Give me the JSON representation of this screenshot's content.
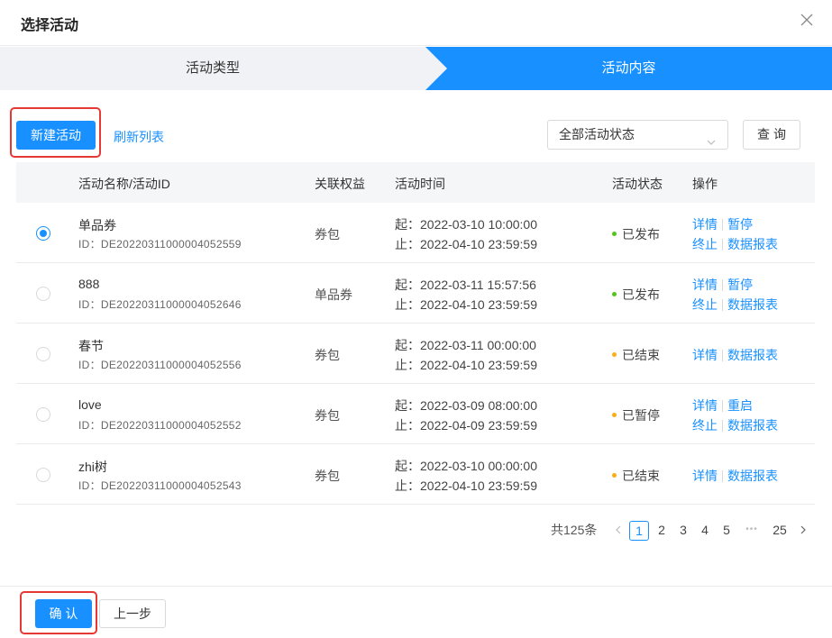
{
  "dialog": {
    "title": "选择活动"
  },
  "steps": [
    {
      "label": "活动类型"
    },
    {
      "label": "活动内容"
    }
  ],
  "toolbar": {
    "new_label": "新建活动",
    "refresh_label": "刷新列表",
    "status_select": "全部活动状态",
    "query_label": "查询"
  },
  "table": {
    "headers": {
      "name": "活动名称/活动ID",
      "benefit": "关联权益",
      "time": "活动时间",
      "status": "活动状态",
      "ops": "操作"
    },
    "rows": [
      {
        "selected": true,
        "name": "单品券",
        "id": "ID：DE20220311000004052559",
        "benefit": "券包",
        "start": "起：2022-03-10 10:00:00",
        "end": "止：2022-04-10 23:59:59",
        "status": "已发布",
        "status_color": "#52c41a",
        "ops_line1": [
          "详情",
          "暂停"
        ],
        "ops_line2": [
          "终止",
          "数据报表"
        ]
      },
      {
        "selected": false,
        "name": "888",
        "id": "ID：DE20220311000004052646",
        "benefit": "单品券",
        "start": "起：2022-03-11 15:57:56",
        "end": "止：2022-04-10 23:59:59",
        "status": "已发布",
        "status_color": "#52c41a",
        "ops_line1": [
          "详情",
          "暂停"
        ],
        "ops_line2": [
          "终止",
          "数据报表"
        ]
      },
      {
        "selected": false,
        "name": "春节",
        "id": "ID：DE20220311000004052556",
        "benefit": "券包",
        "start": "起：2022-03-11 00:00:00",
        "end": "止：2022-04-10 23:59:59",
        "status": "已结束",
        "status_color": "#faad14",
        "ops_line1": [
          "详情",
          "数据报表"
        ],
        "ops_line2": []
      },
      {
        "selected": false,
        "name": "love",
        "id": "ID：DE20220311000004052552",
        "benefit": "券包",
        "start": "起：2022-03-09 08:00:00",
        "end": "止：2022-04-09 23:59:59",
        "status": "已暂停",
        "status_color": "#faad14",
        "ops_line1": [
          "详情",
          "重启"
        ],
        "ops_line2": [
          "终止",
          "数据报表"
        ]
      },
      {
        "selected": false,
        "name": "zhi树",
        "id": "ID：DE20220311000004052543",
        "benefit": "券包",
        "start": "起：2022-03-10 00:00:00",
        "end": "止：2022-04-10 23:59:59",
        "status": "已结束",
        "status_color": "#faad14",
        "ops_line1": [
          "详情",
          "数据报表"
        ],
        "ops_line2": []
      }
    ]
  },
  "pagination": {
    "total": "共125条",
    "pages": [
      "1",
      "2",
      "3",
      "4",
      "5"
    ],
    "current": "1",
    "ellipsis": "•••",
    "last": "25"
  },
  "footer": {
    "confirm_label": "确 认",
    "prev_label": "上一步"
  },
  "colors": {
    "primary": "#1890ff",
    "highlight": "#e53935"
  },
  "icons": {
    "close": "close-icon",
    "dropdown": "chevron-down-icon",
    "prev": "chevron-left-icon",
    "next": "chevron-right-icon"
  }
}
